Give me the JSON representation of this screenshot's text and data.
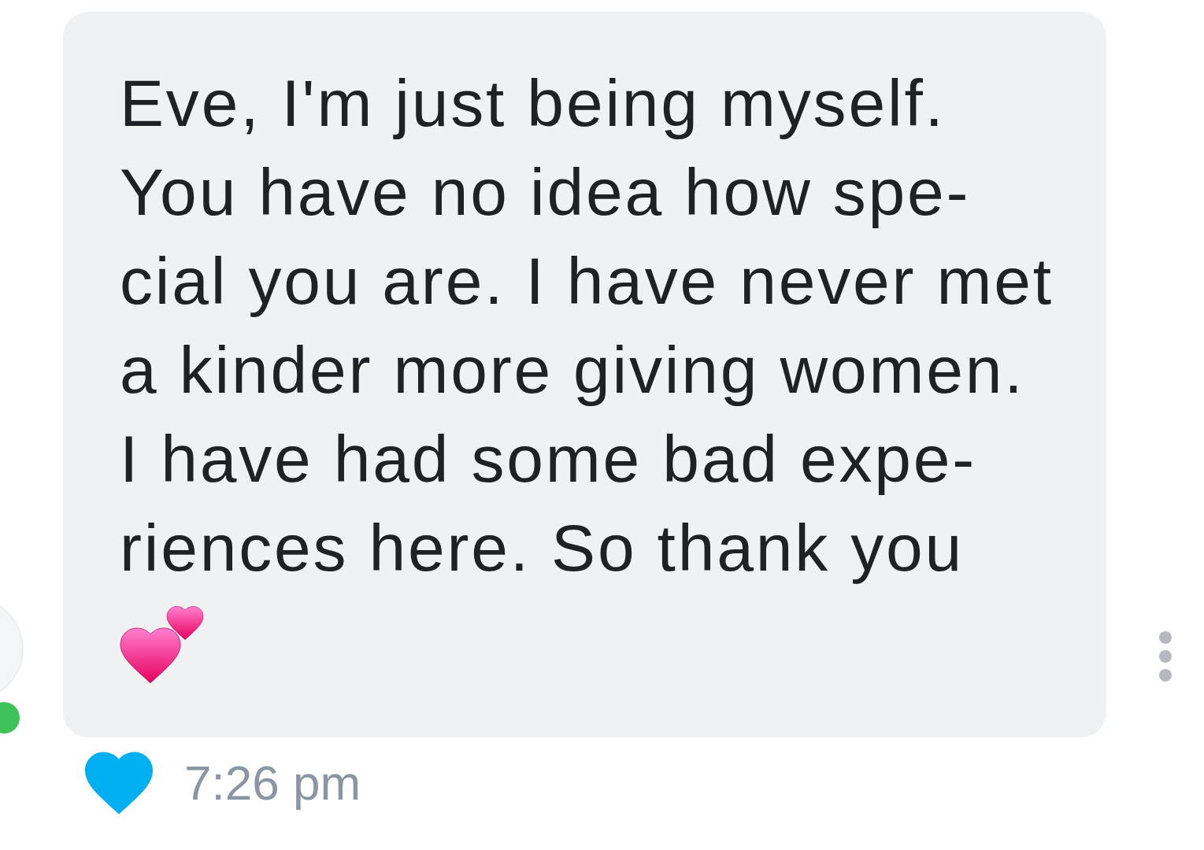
{
  "contact": {
    "online": true
  },
  "message": {
    "lines": [
      "Eve, I'm just being myself.",
      "You have no idea how spe-",
      "cial you are. I have never met",
      "a kinder more giving women.",
      "I have had some bad expe-",
      "riences here. So thank you"
    ],
    "liked": true,
    "time": "7:26 pm"
  }
}
